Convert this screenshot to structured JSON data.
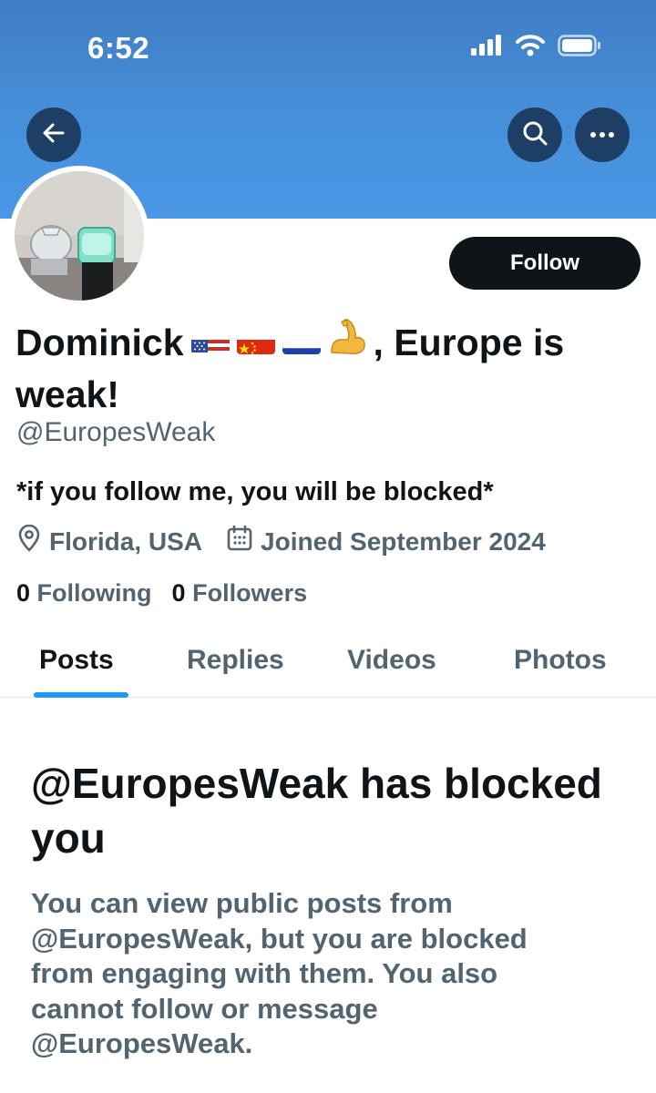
{
  "status_bar": {
    "time": "6:52"
  },
  "header": {
    "back_icon": "arrow-left-icon",
    "search_icon": "search-icon",
    "more_icon": "more-horizontal-icon"
  },
  "profile": {
    "display_name_prefix": "Dominick",
    "display_name_flags": [
      "us-flag-emoji",
      "china-flag-emoji",
      "russia-flag-emoji",
      "flexed-biceps-emoji"
    ],
    "display_name_suffix": ", Europe is weak!",
    "handle": "@EuropesWeak",
    "bio": "*if you follow me, you will be blocked*",
    "location": "Florida, USA",
    "joined": "Joined September 2024",
    "following_count": "0",
    "following_label": "Following",
    "followers_count": "0",
    "followers_label": "Followers",
    "follow_label": "Follow"
  },
  "tabs": [
    {
      "label": "Posts",
      "active": true
    },
    {
      "label": "Replies",
      "active": false
    },
    {
      "label": "Videos",
      "active": false
    },
    {
      "label": "Photos",
      "active": false
    }
  ],
  "blocked_notice": {
    "title": "@EuropesWeak has blocked you",
    "description": "You can view public posts from @EuropesWeak, but you are blocked from engaging with them. You also cannot follow or message @EuropesWeak."
  },
  "colors": {
    "banner": "#4690db",
    "accent": "#1d9bf0",
    "follow_button": "#0f1419",
    "secondary_text": "#536471"
  }
}
